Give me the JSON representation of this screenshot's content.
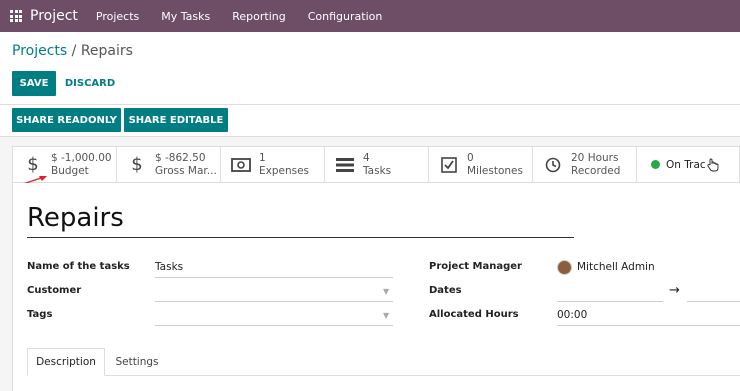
{
  "topbar": {
    "app_name": "Project",
    "menu": [
      "Projects",
      "My Tasks",
      "Reporting",
      "Configuration"
    ]
  },
  "breadcrumb": {
    "parent": "Projects",
    "separator": " / ",
    "current": "Repairs"
  },
  "actions": {
    "save": "SAVE",
    "discard": "DISCARD",
    "share_readonly": "SHARE READONLY",
    "share_editable": "SHARE EDITABLE"
  },
  "stats": [
    {
      "icon": "dollar-icon",
      "value": "$ -1,000.00",
      "label": "Budget"
    },
    {
      "icon": "dollar-icon",
      "value": "$ -862.50",
      "label": "Gross Mar..."
    },
    {
      "icon": "money-bill-icon",
      "value": "1",
      "label": "Expenses"
    },
    {
      "icon": "tasks-icon",
      "value": "4",
      "label": "Tasks"
    },
    {
      "icon": "check-square-icon",
      "value": "0",
      "label": "Milestones"
    },
    {
      "icon": "clock-icon",
      "value": "20 Hours",
      "label": "Recorded"
    },
    {
      "icon": "status-dot-icon",
      "value": "On Trac",
      "label": ""
    }
  ],
  "form": {
    "title": "Repairs",
    "name_of_tasks_label": "Name of the tasks",
    "name_of_tasks_value": "Tasks",
    "customer_label": "Customer",
    "customer_value": "",
    "tags_label": "Tags",
    "tags_value": "",
    "project_manager_label": "Project Manager",
    "project_manager_value": "Mitchell Admin",
    "dates_label": "Dates",
    "dates_arrow": "→",
    "allocated_hours_label": "Allocated Hours",
    "allocated_hours_value": "00:00"
  },
  "tabs": [
    "Description",
    "Settings"
  ],
  "colors": {
    "brand": "#6e4d67",
    "primary": "#017e84",
    "on_track": "#28a745",
    "annotation_arrow": "#e0202a"
  }
}
